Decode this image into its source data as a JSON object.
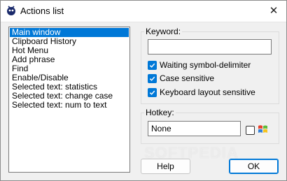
{
  "window": {
    "title": "Actions list",
    "close_glyph": "✕"
  },
  "actions": [
    {
      "label": "Main window",
      "selected": true
    },
    {
      "label": "Clipboard History"
    },
    {
      "label": "Hot Menu"
    },
    {
      "label": "Add phrase"
    },
    {
      "label": "Find"
    },
    {
      "label": "Enable/Disable"
    },
    {
      "label": "Selected text: statistics"
    },
    {
      "label": "Selected text: change case"
    },
    {
      "label": "Selected text: num to text"
    }
  ],
  "keyword": {
    "label": "Keyword:",
    "value": "",
    "options": [
      {
        "label": "Waiting symbol-delimiter",
        "checked": true
      },
      {
        "label": "Case sensitive",
        "checked": true
      },
      {
        "label": "Keyboard layout sensitive",
        "checked": true
      }
    ]
  },
  "hotkey": {
    "label": "Hotkey:",
    "value": "None",
    "win_checked": false,
    "win_icon": "windows-logo-icon"
  },
  "buttons": {
    "help": "Help",
    "ok": "OK"
  },
  "colors": {
    "accent": "#0078d7"
  }
}
